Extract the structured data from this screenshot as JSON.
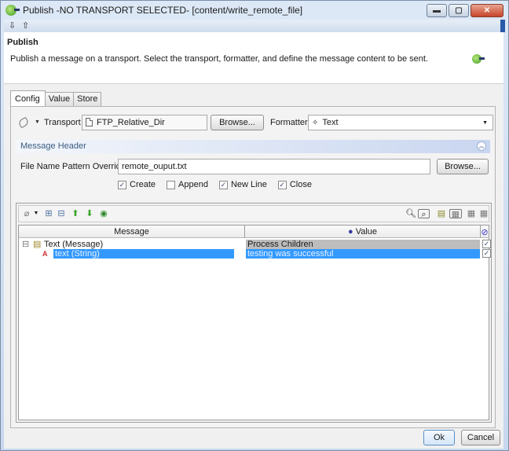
{
  "window": {
    "title": "Publish -NO TRANSPORT SELECTED- [content/write_remote_file]",
    "controls": {
      "minimize": "▬",
      "maximize": "▢",
      "close": "✕"
    }
  },
  "toolbar": {
    "icons": [
      "import-icon",
      "export-icon"
    ]
  },
  "header": {
    "title": "Publish",
    "description": "Publish a message on a transport. Select the transport, formatter, and define the message content to be sent."
  },
  "tabs": [
    {
      "label": "Config",
      "active": true
    },
    {
      "label": "Value",
      "active": false
    },
    {
      "label": "Store",
      "active": false
    }
  ],
  "config": {
    "transport_label": "Transport",
    "transport_value": "FTP_Relative_Dir",
    "browse_label": "Browse...",
    "formatter_label": "Formatter",
    "formatter_value": "Text",
    "message_header_label": "Message Header",
    "file_name_label": "File Name Pattern Override",
    "file_name_value": "remote_ouput.txt",
    "file_browse_label": "Browse...",
    "options": [
      {
        "label": "Create",
        "checked": true
      },
      {
        "label": "Append",
        "checked": false
      },
      {
        "label": "New Line",
        "checked": true
      },
      {
        "label": "Close",
        "checked": true
      }
    ]
  },
  "tree": {
    "columns": {
      "message": "Message",
      "value": "Value"
    },
    "rows": [
      {
        "message": "Text (Message)",
        "value": "Process Children",
        "checked": true,
        "selected": false
      },
      {
        "message": "text (String)",
        "value": "testing was successful",
        "checked": true,
        "selected": true
      }
    ]
  },
  "footer": {
    "ok_label": "Ok",
    "cancel_label": "Cancel"
  }
}
